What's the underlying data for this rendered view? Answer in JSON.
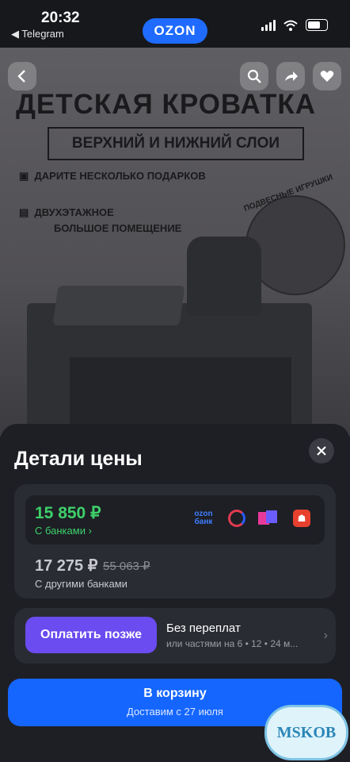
{
  "status_bar": {
    "time": "20:32",
    "back_app": "◀ Telegram",
    "app_pill": "OZON"
  },
  "product_image": {
    "title": "ДЕТСКАЯ КРОВАТКА",
    "subtitle": "ВЕРХНИЙ И НИЖНИЙ СЛОИ",
    "feature_1": "ДАРИТЕ НЕСКОЛЬКО ПОДАРКОВ",
    "feature_2_line1": "ДВУХЭТАЖНОЕ",
    "feature_2_line2": "БОЛЬШОЕ ПОМЕЩЕНИЕ",
    "hanging_toys": "ПОДВЕСНЫЕ ИГРУШКИ"
  },
  "sheet": {
    "title": "Детали цены",
    "bank_price": "15 850 ₽",
    "bank_price_label": "С банками ›",
    "bank_logo_ozon": "ozon банк",
    "other_price": "17 275 ₽",
    "old_price": "55 063 ₽",
    "other_price_label": "С другими банками",
    "pay_later_button": "Оплатить позже",
    "pay_later_title": "Без переплат",
    "pay_later_subtitle": "или частями на 6 • 12 • 24 м...",
    "cart_button": "В корзину",
    "delivery": "Доставим с 27 июля"
  },
  "watermark": "MSKOB",
  "colors": {
    "accent": "#1466ff",
    "green": "#3ed06a",
    "purple": "#6a4cf0",
    "sheet_bg": "#1e1f25"
  }
}
